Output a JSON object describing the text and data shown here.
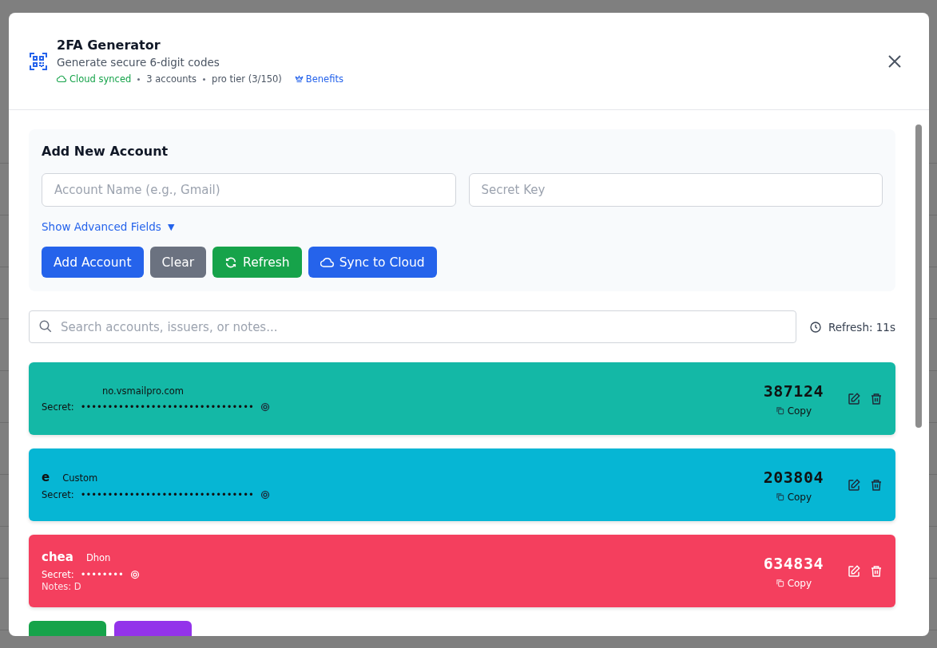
{
  "modal": {
    "title": "2FA Generator",
    "subtitle": "Generate secure 6-digit codes",
    "sync_status": "Cloud synced",
    "account_count": "3 accounts",
    "tier": "pro tier (3/150)",
    "benefits_link": "Benefits"
  },
  "add_account": {
    "title": "Add New Account",
    "name_field": {
      "placeholder": "Account Name (e.g., Gmail)"
    },
    "secret_field": {
      "placeholder": "Secret Key"
    },
    "advanced_toggle": "Show Advanced Fields",
    "advanced_caret": "▼",
    "buttons": [
      {
        "label": "Add Account",
        "kind": "primary"
      },
      {
        "label": "Clear",
        "kind": "neutral"
      },
      {
        "label": "Refresh",
        "kind": "refresh"
      },
      {
        "label": "Sync to Cloud",
        "kind": "cloud"
      }
    ]
  },
  "search": {
    "placeholder": "Search accounts, issuers, or notes..."
  },
  "refresh_timer": "Refresh: 11s",
  "accounts": [
    {
      "issuer": "no.vsmailpro.com",
      "secret_label": "Secret:",
      "secret": "••••••••••••••••••••••••••••••••",
      "code": "387124",
      "copy_label": "Copy",
      "color": "#14b8a6",
      "kind": "dark"
    },
    {
      "name": "e",
      "issuer": "Custom",
      "secret_label": "Secret:",
      "secret": "••••••••••••••••••••••••••••••••",
      "code": "203804",
      "copy_label": "Copy",
      "color": "#06b6d4",
      "kind": "dark"
    },
    {
      "name": "chea",
      "issuer": "Dhon",
      "secret_label": "Secret:",
      "secret": "••••••••",
      "notes": "Notes: D",
      "code": "634834",
      "copy_label": "Copy",
      "color": "#f43f5e",
      "kind": "light"
    }
  ],
  "next_card_tags": [
    {
      "color": "#16a34a"
    },
    {
      "color": "#9333ea"
    }
  ]
}
